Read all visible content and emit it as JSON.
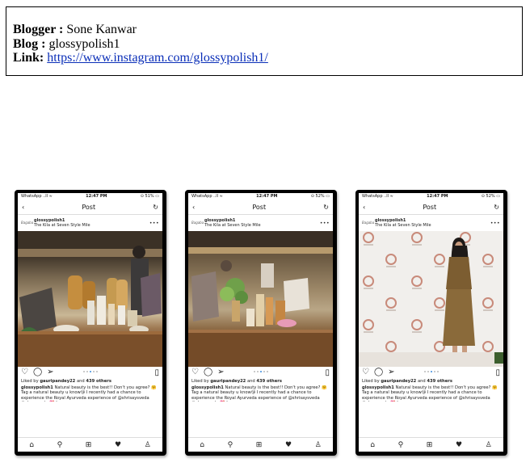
{
  "info": {
    "blogger_label": "Blogger :",
    "blogger_name": "Sone Kanwar",
    "blog_label": "Blog :",
    "blog_name": "glossypolish1",
    "link_label": "Link:",
    "link_url": "https://www.instagram.com/glossypolish1/"
  },
  "phones": [
    {
      "status_left": "WhatsApp ..ll ≈",
      "time": "12:47 PM",
      "battery": "⊙ 51% ▭",
      "nav_title": "Post",
      "username": "glossypolish1",
      "location": "The Kila at Seven Style Mile",
      "avatar_text": "Bagaba",
      "liked_by": "Liked by",
      "liker": "gauripandey22",
      "and_text": "and",
      "others": "439 others",
      "caption_user": "glossypolish1",
      "caption_text": "Natural beauty is the best!! Don't you agree? 🤗 Tag a natural beauty u know😘 I recently had a chance to experience the Royal Ayurveda experience of @shrisaysveda #glossyveda 💖 I am"
    },
    {
      "status_left": "WhatsApp ..ll ≈",
      "time": "12:47 PM",
      "battery": "⊙ 52% ▭",
      "nav_title": "Post",
      "username": "glossypolish1",
      "location": "The Kila at Seven Style Mile",
      "avatar_text": "Bagaba",
      "liked_by": "Liked by",
      "liker": "gauripandey22",
      "and_text": "and",
      "others": "439 others",
      "caption_user": "glossypolish1",
      "caption_text": "Natural beauty is the best!! Don't you agree? 🤗 Tag a natural beauty u know😘 I recently had a chance to experience the Royal Ayurveda experience of @shrisaysveda #glossyveda 💖 I am"
    },
    {
      "status_left": "WhatsApp ..ll ≈",
      "time": "12:47 PM",
      "battery": "⊙ 52% ▭",
      "nav_title": "Post",
      "username": "glossypolish1",
      "location": "The Kila at Seven Style Mile",
      "avatar_text": "Bagaba",
      "liked_by": "Liked by",
      "liker": "gauripandey22",
      "and_text": "and",
      "others": "439 others",
      "caption_user": "glossypolish1",
      "caption_text": "Natural beauty is the best!! Don't you agree? 🤗 Tag a natural beauty u know😘 I recently had a chance to experience the Royal Ayurveda experience of @shrisaysveda #glossyveda 💖 I am"
    }
  ],
  "icons": {
    "back": "back-chevron-icon",
    "refresh": "refresh-icon",
    "more": "more-dots-icon",
    "like": "heart-outline-icon",
    "comment": "comment-icon",
    "share": "send-icon",
    "bookmark": "bookmark-icon",
    "tab_home": "home-icon",
    "tab_search": "search-icon",
    "tab_add": "add-post-icon",
    "tab_activity": "heart-filled-icon",
    "tab_profile": "profile-icon"
  },
  "colors": {
    "link": "#0a2eb8",
    "pager_active": "#3a8de0"
  }
}
